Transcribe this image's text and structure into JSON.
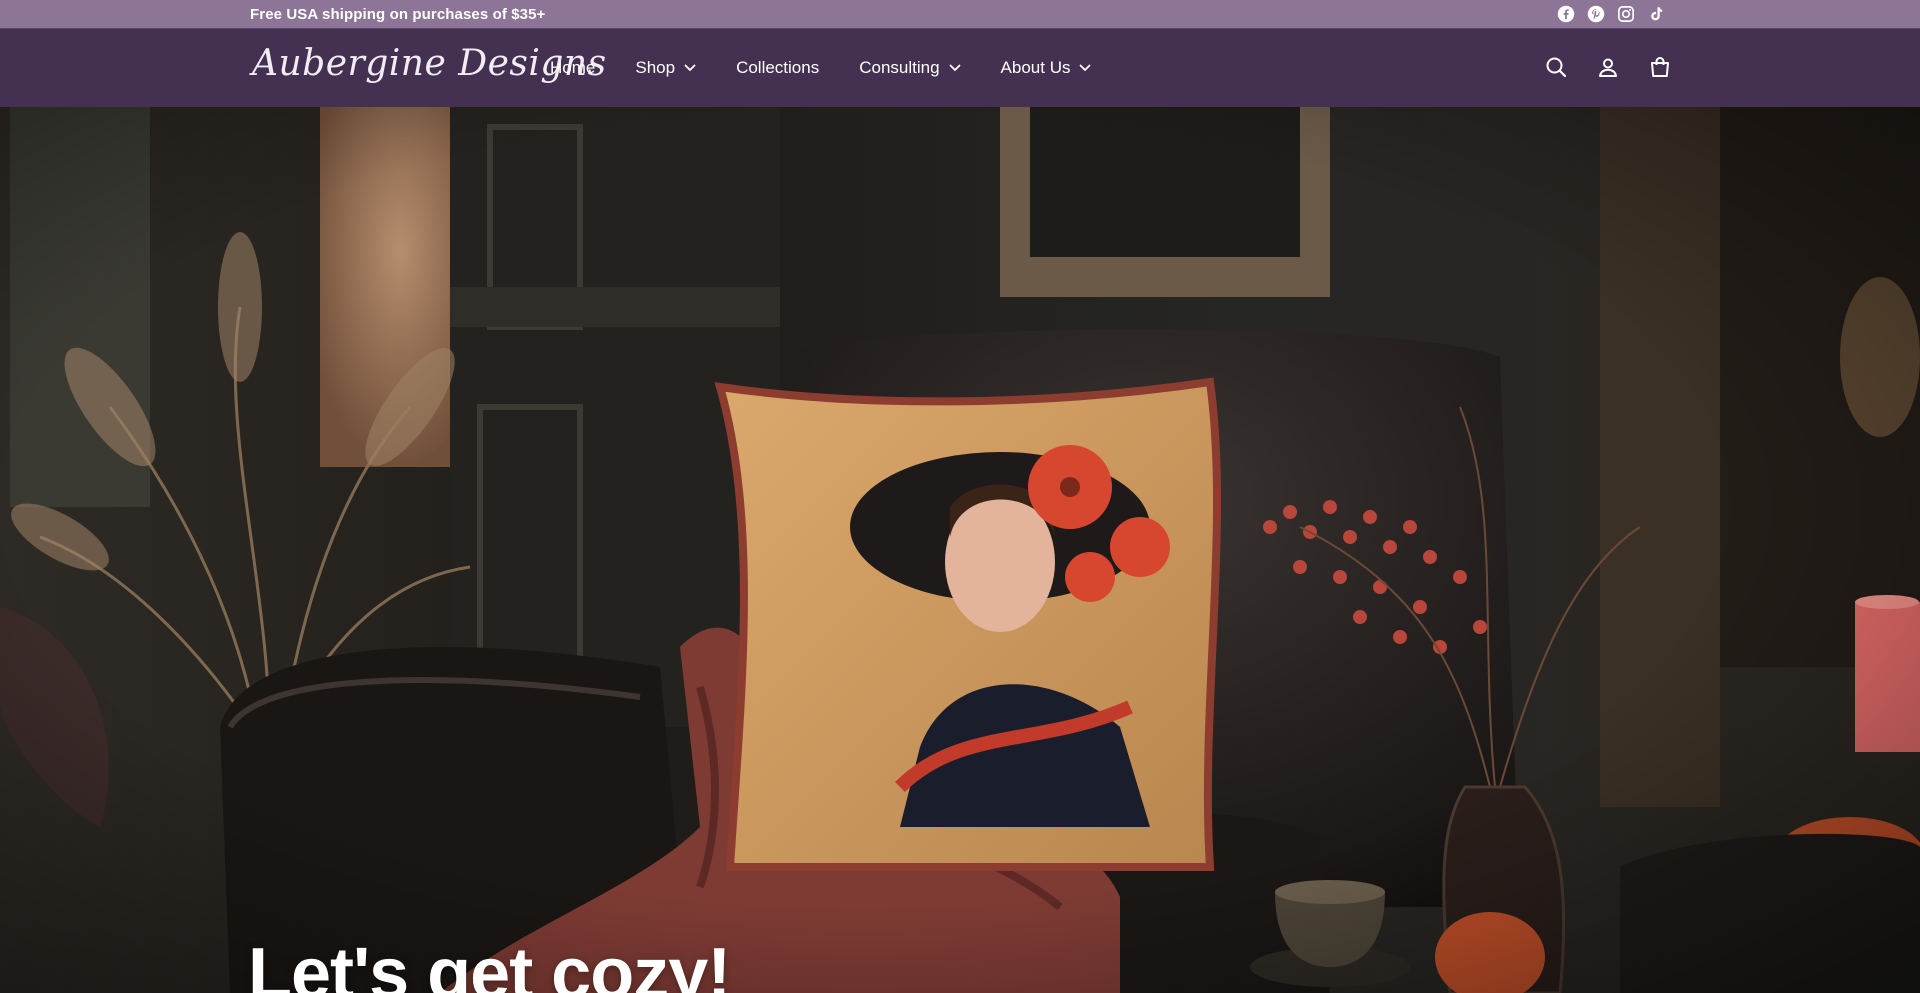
{
  "announcement": {
    "text": "Free USA shipping on purchases of $35+"
  },
  "social": [
    {
      "icon": "facebook-icon"
    },
    {
      "icon": "pinterest-icon"
    },
    {
      "icon": "instagram-icon"
    },
    {
      "icon": "tiktok-icon"
    }
  ],
  "header": {
    "logo": "Aubergine Designs",
    "nav": [
      {
        "label": "Home",
        "dropdown": false
      },
      {
        "label": "Shop",
        "dropdown": true
      },
      {
        "label": "Collections",
        "dropdown": false
      },
      {
        "label": "Consulting",
        "dropdown": true
      },
      {
        "label": "About Us",
        "dropdown": true
      }
    ],
    "icons": [
      "search-icon",
      "account-icon",
      "cart-icon"
    ]
  },
  "hero": {
    "title": "Let's get cozy!"
  },
  "colors": {
    "announcement_bg": "#8c7596",
    "header_bg": "#443152",
    "text": "#ffffff"
  }
}
